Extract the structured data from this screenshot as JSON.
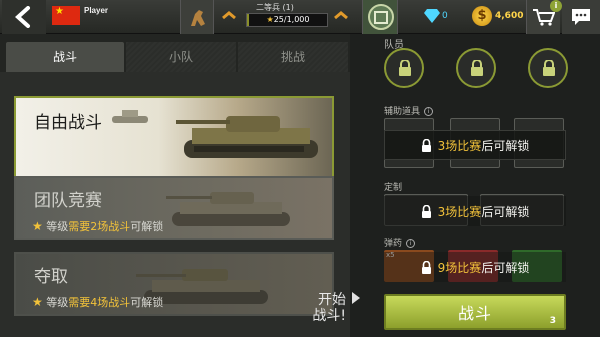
{
  "header": {
    "player_name": "Player",
    "rank_title": "二等兵 (1)",
    "xp_text": "25/1,000",
    "xp_fraction": 0.025,
    "gems": "0",
    "coins": "4,600",
    "cart_badge": "i"
  },
  "tabs": [
    {
      "label": "战斗",
      "active": true
    },
    {
      "label": "小队",
      "active": false
    },
    {
      "label": "挑战",
      "active": false
    }
  ],
  "modes": [
    {
      "title": "自由战斗"
    },
    {
      "title": "团队竞赛",
      "req_prefix": "等级",
      "req_yellow": "需要2场战斗",
      "req_suffix": "可解锁"
    },
    {
      "title": "夺取",
      "req_prefix": "等级",
      "req_yellow": "需要4场战斗",
      "req_suffix": "可解锁"
    }
  ],
  "start_label_line1": "开始",
  "start_label_line2": "战斗!",
  "crew": {
    "title": "队员"
  },
  "support": {
    "title": "辅助道具",
    "lock_yellow": "3场比赛",
    "lock_suffix": "后可解锁"
  },
  "custom": {
    "title": "定制",
    "lock_yellow": "3场比赛",
    "lock_suffix": "后可解锁"
  },
  "ammo": {
    "title": "弹药",
    "lock_yellow": "9场比赛",
    "lock_suffix": "后可解锁",
    "badge": "x5",
    "colors": [
      "#8a4a1e",
      "#8a2a2a",
      "#2f6a2a"
    ]
  },
  "fight_button": {
    "label": "战斗",
    "count": "3"
  },
  "colors": {
    "accent": "#8da02c",
    "highlight": "#f2c23a",
    "gem": "#4fd7ff"
  }
}
